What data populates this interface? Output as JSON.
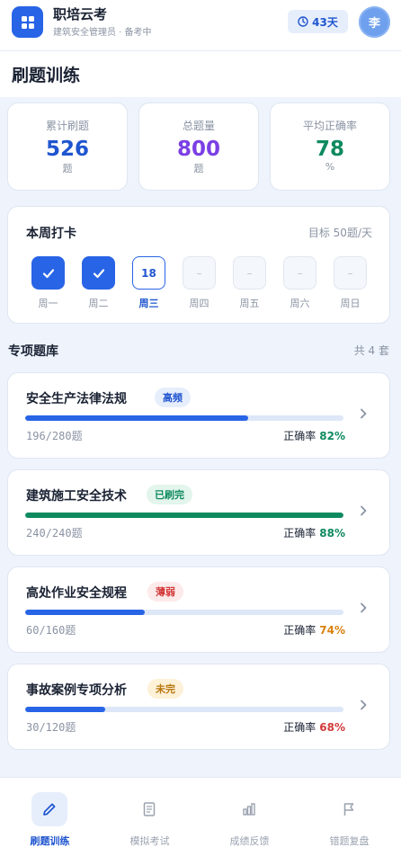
{
  "app": {
    "name": "职培云考",
    "subtitle": "建筑安全管理员 · 备考中",
    "days_left": "43天",
    "avatar_initial": "李"
  },
  "page": {
    "title": "刷题训练"
  },
  "stats": [
    {
      "label": "累计刷题",
      "value": "526",
      "unit": "题",
      "color": "#1f55cf"
    },
    {
      "label": "总题量",
      "value": "800",
      "unit": "题",
      "color": "#7b3fe4"
    },
    {
      "label": "平均正确率",
      "value": "78",
      "unit": "%",
      "color": "#0f8a5f"
    }
  ],
  "week": {
    "title": "本周打卡",
    "target": "目标 50题/天",
    "days": [
      {
        "label": "周一",
        "state": "done",
        "text": ""
      },
      {
        "label": "周二",
        "state": "done",
        "text": ""
      },
      {
        "label": "周三",
        "state": "today",
        "text": "18"
      },
      {
        "label": "周四",
        "state": "todo",
        "text": "–"
      },
      {
        "label": "周五",
        "state": "todo",
        "text": "–"
      },
      {
        "label": "周六",
        "state": "todo",
        "text": "–"
      },
      {
        "label": "周日",
        "state": "todo",
        "text": "–"
      }
    ]
  },
  "banks_section": {
    "title": "专项题库",
    "count": "共 4 套"
  },
  "accuracy_label": "正确率",
  "banks": [
    {
      "name": "安全生产法律法规",
      "tag": "高频",
      "tag_color": "#1f55cf",
      "tag_bg": "#e6eefc",
      "done": 196,
      "total": 280,
      "progress_text": "196/280题",
      "bar_color": "#2864e6",
      "accuracy": "82%",
      "accuracy_color": "#0f8a5f"
    },
    {
      "name": "建筑施工安全技术",
      "tag": "已刷完",
      "tag_color": "#0f8a5f",
      "tag_bg": "#e3f5ec",
      "done": 240,
      "total": 240,
      "progress_text": "240/240题",
      "bar_color": "#0f8a5f",
      "accuracy": "88%",
      "accuracy_color": "#0f8a5f"
    },
    {
      "name": "高处作业安全规程",
      "tag": "薄弱",
      "tag_color": "#d23a3a",
      "tag_bg": "#fdeaea",
      "done": 60,
      "total": 160,
      "progress_text": "60/160题",
      "bar_color": "#2864e6",
      "accuracy": "74%",
      "accuracy_color": "#d9820f"
    },
    {
      "name": "事故案例专项分析",
      "tag": "未完",
      "tag_color": "#b9770e",
      "tag_bg": "#fdf1d8",
      "done": 30,
      "total": 120,
      "progress_text": "30/120题",
      "bar_color": "#2864e6",
      "accuracy": "68%",
      "accuracy_color": "#d23a3a"
    }
  ],
  "nav": [
    {
      "label": "刷题训练",
      "icon": "pencil-icon",
      "active": true
    },
    {
      "label": "模拟考试",
      "icon": "document-icon",
      "active": false
    },
    {
      "label": "成绩反馈",
      "icon": "bar-chart-icon",
      "active": false
    },
    {
      "label": "错题复盘",
      "icon": "flag-icon",
      "active": false
    }
  ]
}
